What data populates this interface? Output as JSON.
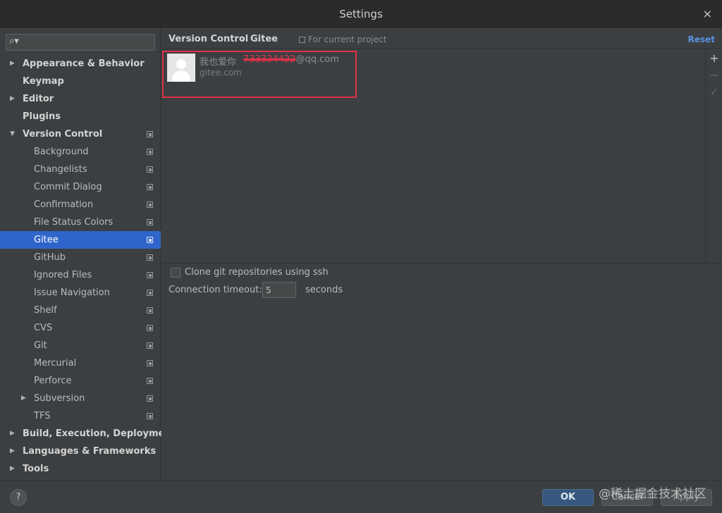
{
  "window": {
    "title": "Settings",
    "close_glyph": "×"
  },
  "search": {
    "placeholder": "",
    "icon": "search-icon"
  },
  "sidebar": {
    "items": [
      {
        "label": "Appearance & Behavior",
        "arrow": "▶"
      },
      {
        "label": "Keymap"
      },
      {
        "label": "Editor",
        "arrow": "▶"
      },
      {
        "label": "Plugins"
      },
      {
        "label": "Version Control",
        "arrow": "▼"
      },
      {
        "label": "Background"
      },
      {
        "label": "Changelists"
      },
      {
        "label": "Commit Dialog"
      },
      {
        "label": "Confirmation"
      },
      {
        "label": "File Status Colors"
      },
      {
        "label": "Gitee"
      },
      {
        "label": "GitHub"
      },
      {
        "label": "Ignored Files"
      },
      {
        "label": "Issue Navigation"
      },
      {
        "label": "Shelf"
      },
      {
        "label": "CVS"
      },
      {
        "label": "Git"
      },
      {
        "label": "Mercurial"
      },
      {
        "label": "Perforce"
      },
      {
        "label": "Subversion",
        "arrow": "▶"
      },
      {
        "label": "TFS"
      },
      {
        "label": "Build, Execution, Deployment",
        "arrow": "▶"
      },
      {
        "label": "Languages & Frameworks",
        "arrow": "▶"
      },
      {
        "label": "Tools",
        "arrow": "▶"
      }
    ]
  },
  "breadcrumb": {
    "parent": "Version Control",
    "sep": "›",
    "current": "Gitee",
    "scope": "For current project"
  },
  "reset_label": "Reset",
  "toolbar": {
    "add": "+",
    "remove": "−",
    "check": "✓"
  },
  "account": {
    "name": "我也爱你",
    "email_redacted": "733334422",
    "email_domain": "@qq.com",
    "server": "gitee.com"
  },
  "options": {
    "clone_ssh_label": "Clone git repositories using ssh",
    "clone_ssh_checked": false,
    "timeout_label": "Connection timeout:",
    "timeout_value": "5",
    "timeout_unit": "seconds"
  },
  "footer": {
    "help": "?",
    "ok": "OK",
    "cancel": "Cancel",
    "apply": "Apply",
    "watermark": "@稀土掘金技术社区"
  },
  "colors": {
    "selection": "#2f65ca",
    "link": "#5894e3",
    "highlight_box": "#e23048"
  }
}
